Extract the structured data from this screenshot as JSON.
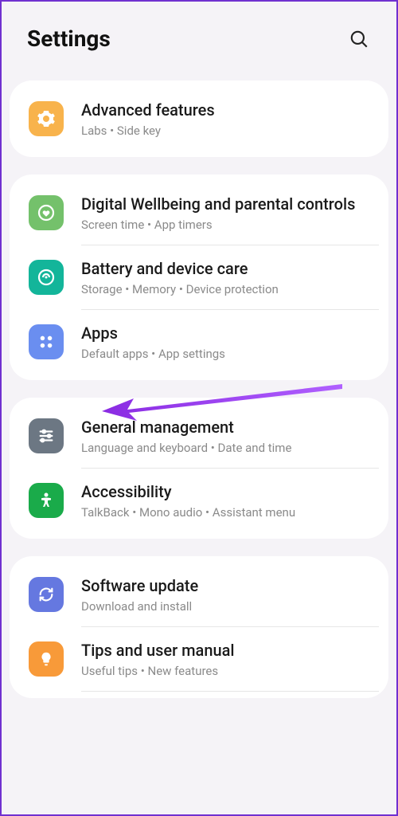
{
  "header": {
    "title": "Settings"
  },
  "groups": [
    [
      {
        "id": "advanced-features",
        "title": "Advanced features",
        "sub": "Labs  •  Side key",
        "iconBg": "#f8b34c",
        "iconName": "gear-icon"
      }
    ],
    [
      {
        "id": "digital-wellbeing",
        "title": "Digital Wellbeing and parental controls",
        "sub": "Screen time  •  App timers",
        "iconBg": "#74c16b",
        "iconName": "heart-circle-icon"
      },
      {
        "id": "battery-device-care",
        "title": "Battery and device care",
        "sub": "Storage  •  Memory  •  Device protection",
        "iconBg": "#13b59a",
        "iconName": "care-icon"
      },
      {
        "id": "apps",
        "title": "Apps",
        "sub": "Default apps  •  App settings",
        "iconBg": "#6a8ef0",
        "iconName": "apps-grid-icon"
      }
    ],
    [
      {
        "id": "general-management",
        "title": "General management",
        "sub": "Language and keyboard  •  Date and time",
        "iconBg": "#6c7783",
        "iconName": "sliders-icon"
      },
      {
        "id": "accessibility",
        "title": "Accessibility",
        "sub": "TalkBack  •  Mono audio  •  Assistant menu",
        "iconBg": "#1aab4a",
        "iconName": "person-icon"
      }
    ],
    [
      {
        "id": "software-update",
        "title": "Software update",
        "sub": "Download and install",
        "iconBg": "#6578e0",
        "iconName": "refresh-icon"
      },
      {
        "id": "tips-user-manual",
        "title": "Tips and user manual",
        "sub": "Useful tips  •  New features",
        "iconBg": "#f89a39",
        "iconName": "lightbulb-icon"
      }
    ]
  ],
  "annotation": {
    "pointsTo": "apps"
  }
}
